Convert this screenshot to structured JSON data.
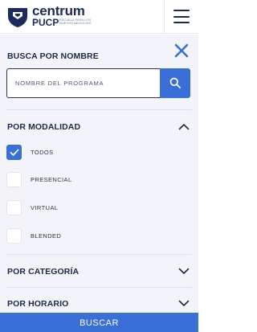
{
  "header": {
    "logo_word": "centrum",
    "logo_pucp": "PUCP",
    "logo_sub": "ESCUELA PARA LOS NUEVOS NEGOCIOS"
  },
  "search": {
    "title": "BUSCA POR NOMBRE",
    "placeholder": "NOMBRE DEL PROGRAMA"
  },
  "modalidad": {
    "title": "POR MODALIDAD",
    "expanded": true,
    "options": [
      {
        "label": "TODOS",
        "checked": true
      },
      {
        "label": "PRESENCIAL",
        "checked": false
      },
      {
        "label": "VIRTUAL",
        "checked": false
      },
      {
        "label": "BLENDED",
        "checked": false
      }
    ]
  },
  "categoria": {
    "title": "POR CATEGORÍA",
    "expanded": false
  },
  "horario": {
    "title": "POR HORARIO",
    "expanded": false
  },
  "footer": {
    "button_label": "BUSCAR"
  },
  "colors": {
    "primary": "#3a6fd8",
    "navy": "#1c2b4a",
    "panel_bg": "#f2f4f9"
  }
}
